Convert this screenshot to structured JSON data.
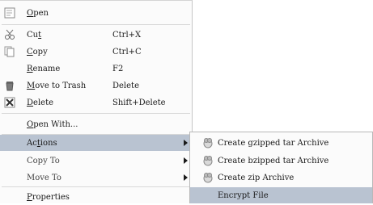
{
  "menu": {
    "items": [
      {
        "label_pre": "",
        "label_u": "O",
        "label_post": "pen",
        "accel": "",
        "icon": "open-icon"
      },
      {
        "label_pre": "Cu",
        "label_u": "t",
        "label_post": "",
        "accel": "Ctrl+X",
        "icon": "scissors-icon"
      },
      {
        "label_pre": "",
        "label_u": "C",
        "label_post": "opy",
        "accel": "Ctrl+C",
        "icon": "copy-icon"
      },
      {
        "label_pre": "",
        "label_u": "R",
        "label_post": "ename",
        "accel": "F2",
        "icon": ""
      },
      {
        "label_pre": "",
        "label_u": "M",
        "label_post": "ove to Trash",
        "accel": "Delete",
        "icon": "trash-icon"
      },
      {
        "label_pre": "",
        "label_u": "D",
        "label_post": "elete",
        "accel": "Shift+Delete",
        "icon": "delete-icon"
      },
      {
        "label_pre": "",
        "label_u": "O",
        "label_post": "pen With...",
        "accel": "",
        "icon": ""
      },
      {
        "label_pre": "Ac",
        "label_u": "t",
        "label_post": "ions",
        "accel": "",
        "icon": ""
      },
      {
        "label_pre": "",
        "label_u": "",
        "label_post": "Copy To",
        "accel": "",
        "icon": ""
      },
      {
        "label_pre": "",
        "label_u": "",
        "label_post": "Move To",
        "accel": "",
        "icon": ""
      },
      {
        "label_pre": "",
        "label_u": "P",
        "label_post": "roperties",
        "accel": "",
        "icon": ""
      }
    ]
  },
  "submenu": {
    "items": [
      {
        "label": "Create gzipped tar Archive",
        "icon": "archive-icon"
      },
      {
        "label": "Create bzipped tar Archive",
        "icon": "archive-icon"
      },
      {
        "label": "Create zip Archive",
        "icon": "archive-icon"
      },
      {
        "label": "Encrypt File",
        "icon": ""
      }
    ]
  },
  "colors": {
    "highlight": "#b9c3d1",
    "menu_bg": "#fbfbfb"
  }
}
